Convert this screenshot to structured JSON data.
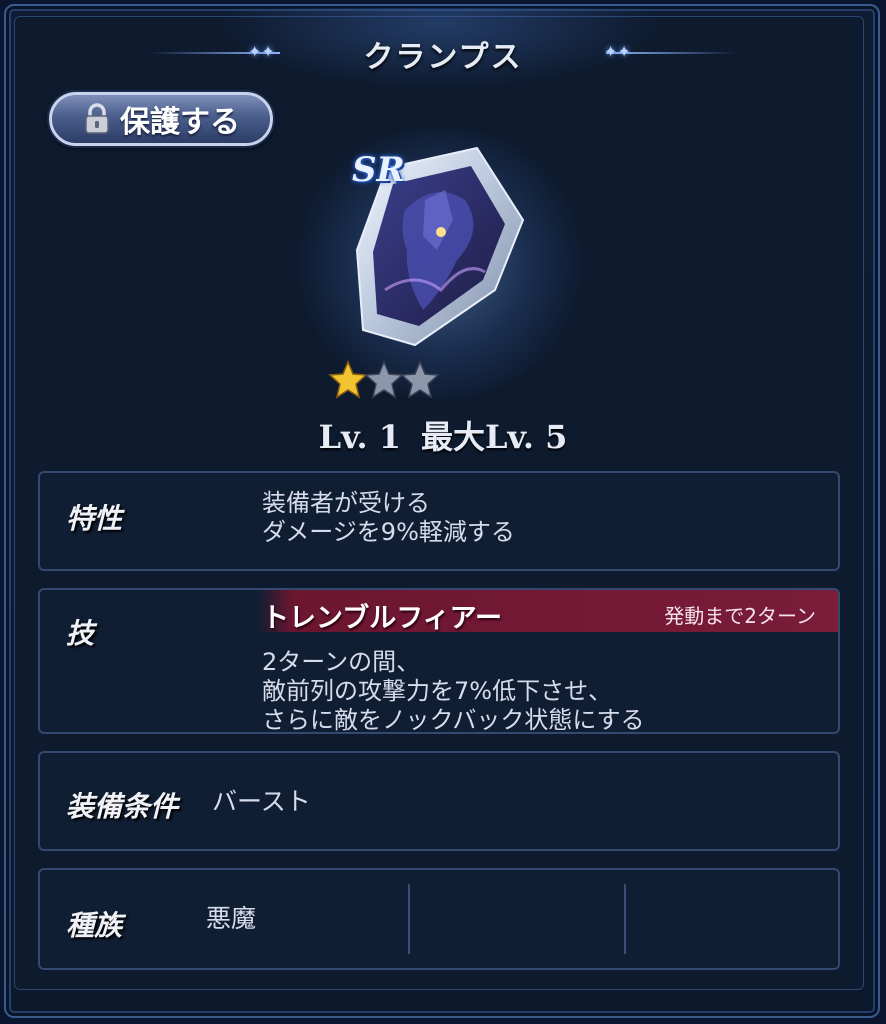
{
  "title": "クランプス",
  "protect_button": {
    "label": "保護する",
    "icon": "lock-icon"
  },
  "item": {
    "rarity": "SR",
    "stars": {
      "filled": 1,
      "total": 3
    },
    "level_label": "Lv. 1",
    "max_level_label": "最大Lv. 5"
  },
  "trait": {
    "heading": "特性",
    "lines": [
      "装備者が受ける",
      "ダメージを9%軽減する"
    ]
  },
  "skill": {
    "heading": "技",
    "name": "トレンブルフィアー",
    "cooldown": "発動まで2ターン",
    "lines": [
      "2ターンの間、",
      "敵前列の攻撃力を7%低下させ、",
      "さらに敵をノックバック状態にする"
    ]
  },
  "equip_condition": {
    "heading": "装備条件",
    "value": "バースト"
  },
  "race": {
    "heading": "種族",
    "values": [
      "悪魔",
      "",
      ""
    ]
  },
  "colors": {
    "accent_star": "#f2c431",
    "skill_bar": "#7a1c3a",
    "panel_border": "#34496e"
  }
}
